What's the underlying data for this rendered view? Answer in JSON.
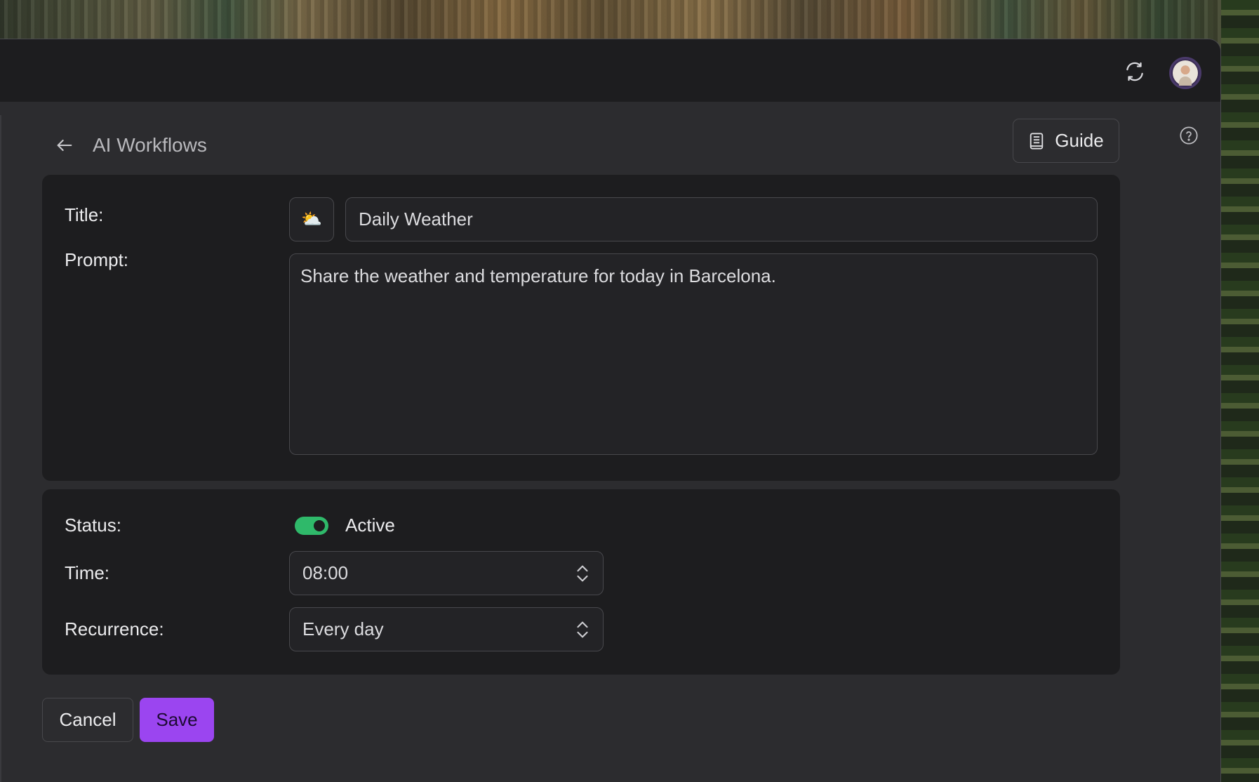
{
  "header": {
    "title": "AI Workflows",
    "guide_label": "Guide"
  },
  "form": {
    "title_label": "Title:",
    "title_value": "Daily Weather",
    "emoji": "⛅",
    "prompt_label": "Prompt:",
    "prompt_value": "Share the weather and temperature for today in Barcelona.",
    "status_label": "Status:",
    "status_value": "Active",
    "status_on": true,
    "time_label": "Time:",
    "time_value": "08:00",
    "recurrence_label": "Recurrence:",
    "recurrence_value": "Every day"
  },
  "actions": {
    "cancel_label": "Cancel",
    "save_label": "Save"
  },
  "colors": {
    "accent": "#9b45f0",
    "toggle_on": "#2fb96a"
  }
}
